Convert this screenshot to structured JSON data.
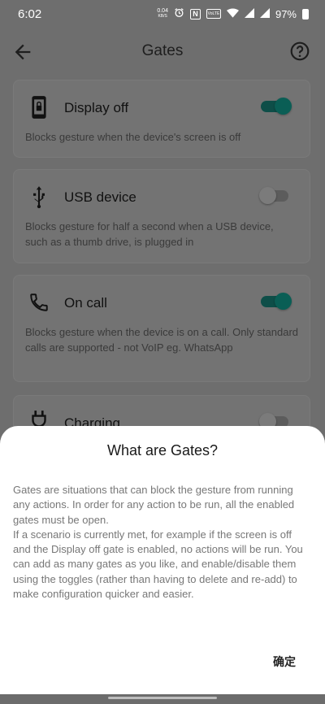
{
  "status_bar": {
    "time": "6:02",
    "net_speed_value": "0.04",
    "net_speed_unit": "KB/S",
    "nfc_glyph": "N",
    "volte_label": "VoLTE",
    "battery_percent": "97%",
    "icons": [
      "alarm-icon",
      "nfc-icon",
      "volte-icon",
      "wifi-icon",
      "signal-icon",
      "battery-icon"
    ]
  },
  "app_bar": {
    "title": "Gates",
    "icons": [
      "arrow-back-icon",
      "help-icon"
    ]
  },
  "gates": [
    {
      "title": "Display off",
      "description": "Blocks gesture when the device's screen is off",
      "enabled": true,
      "icon": "phone-lock-icon"
    },
    {
      "title": "USB device",
      "description": "Blocks gesture for half a second when a USB device, such as a thumb drive, is plugged in",
      "enabled": false,
      "icon": "usb-icon"
    },
    {
      "title": "On call",
      "description": "Blocks gesture when the device is on a call. Only standard calls are supported - not VoIP eg. WhatsApp",
      "enabled": true,
      "icon": "phone-call-icon"
    },
    {
      "title": "Charging",
      "enabled": false,
      "icon": "power-plug-icon"
    }
  ],
  "dialog": {
    "title": "What are Gates?",
    "paragraph_1": "Gates are situations that can block the gesture from running any actions. In order for any action to be run, all the enabled gates must be open.",
    "paragraph_2": "If a scenario is currently met, for example if the screen is off and the Display off gate is enabled, no actions will be run. You can add as many gates as you like, and enable/disable them using the toggles (rather than having to delete and re-add) to make configuration quicker and easier.",
    "confirm_label": "确定"
  },
  "colors": {
    "accent": "#0a5e55",
    "scrim_background": "#6e6e6e",
    "dialog_background": "#ffffff"
  }
}
